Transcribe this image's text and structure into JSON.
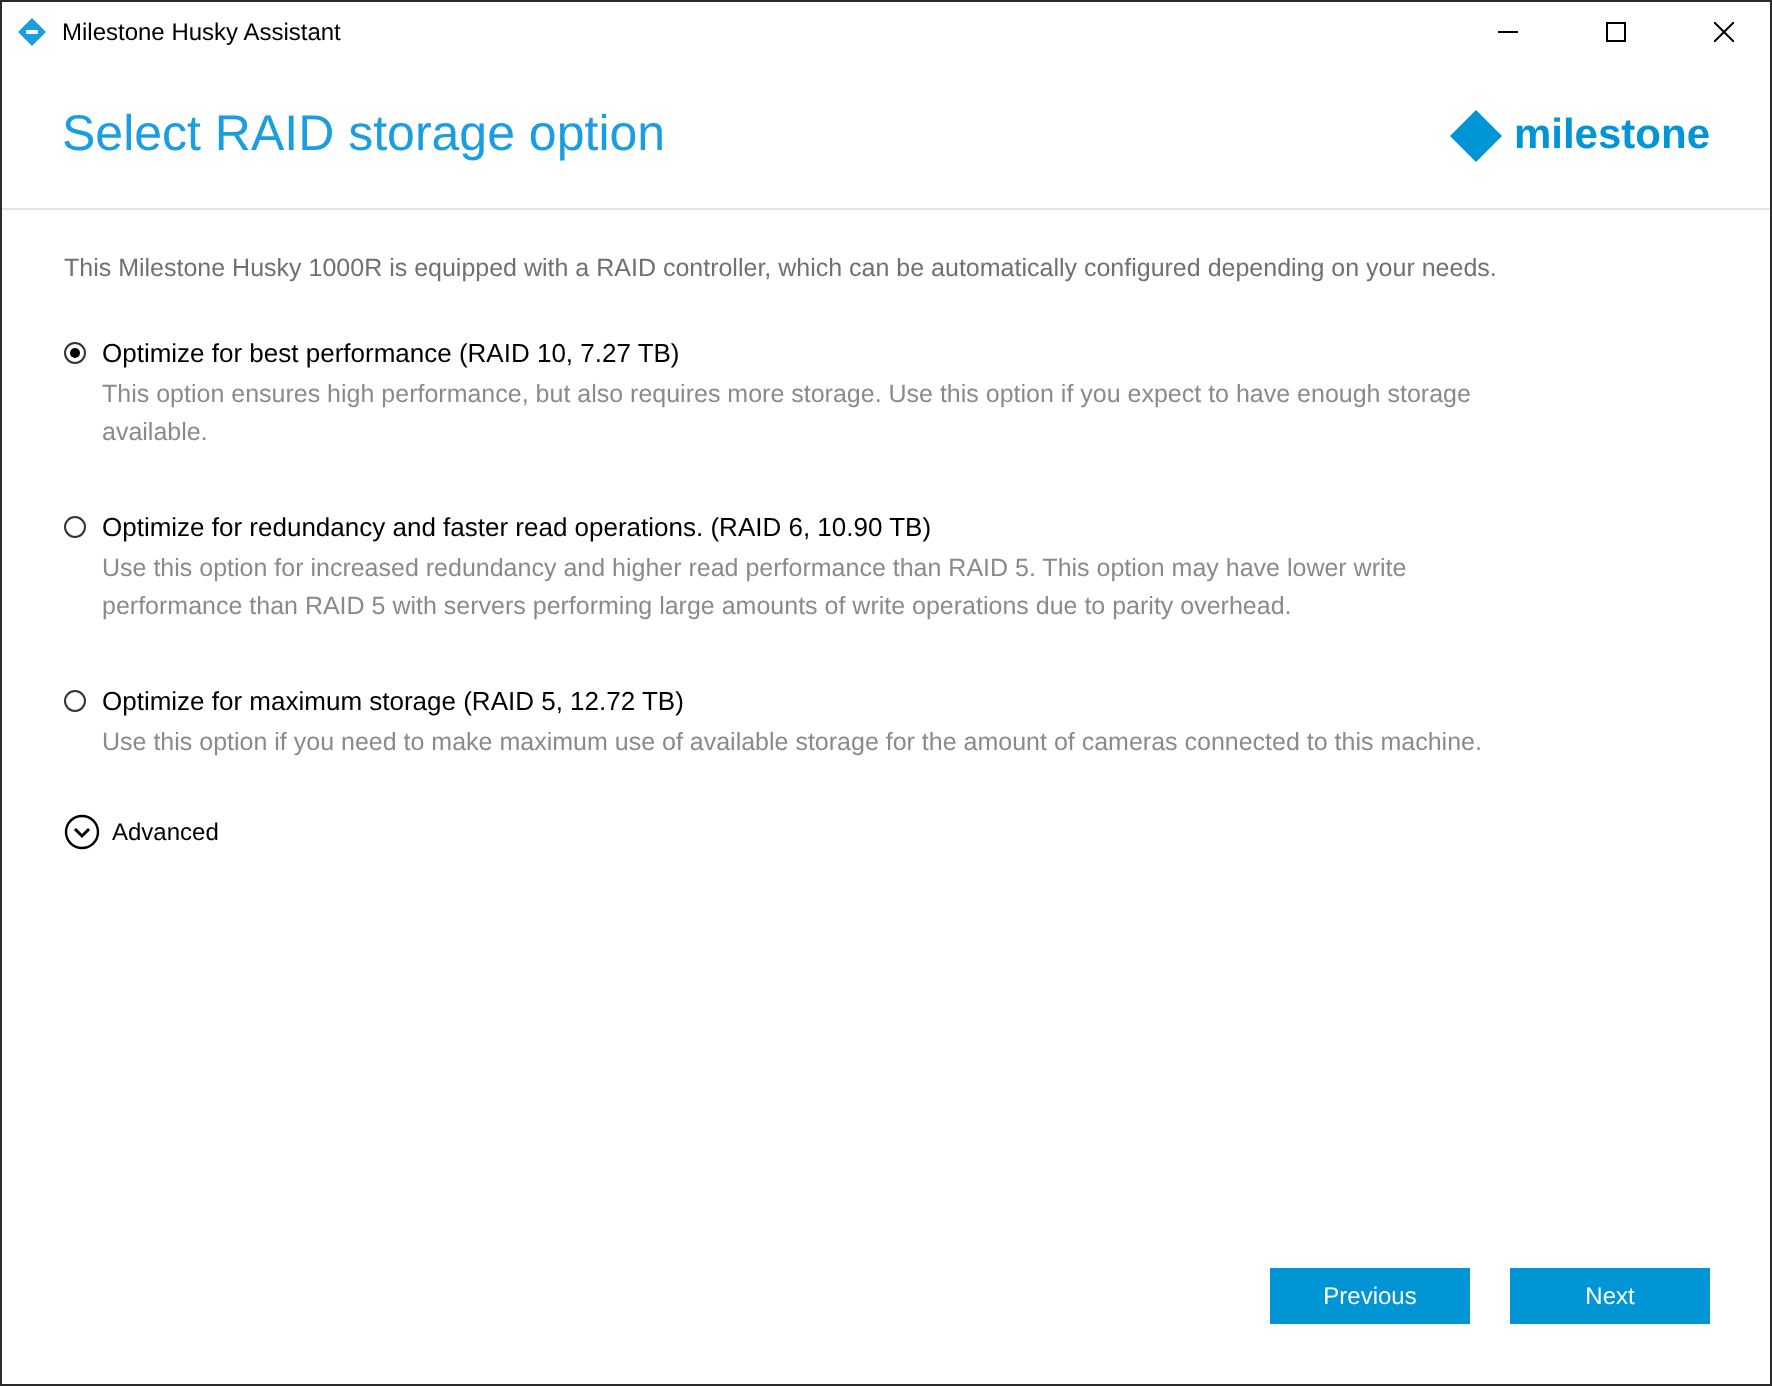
{
  "window": {
    "title": "Milestone Husky Assistant"
  },
  "header": {
    "title": "Select RAID storage option",
    "logo_text": "milestone"
  },
  "intro": "This Milestone Husky 1000R is equipped with a RAID controller, which can be automatically configured depending on your needs.",
  "options": [
    {
      "label": "Optimize for best performance (RAID 10, 7.27 TB)",
      "description": "This option ensures high performance, but also requires more storage. Use this option if you expect to have enough storage available.",
      "selected": true
    },
    {
      "label": "Optimize for redundancy and faster read operations. (RAID 6, 10.90 TB)",
      "description": "Use this option for increased redundancy and higher read performance than RAID 5. This option may have lower write performance than RAID 5 with servers performing large amounts of write operations due to parity overhead.",
      "selected": false
    },
    {
      "label": "Optimize for maximum storage (RAID 5, 12.72 TB)",
      "description": "Use this option if you need to make maximum use of available storage for the amount of cameras connected to this machine.",
      "selected": false
    }
  ],
  "advanced": {
    "label": "Advanced",
    "expanded": false
  },
  "buttons": [
    "Previous",
    "Next"
  ]
}
